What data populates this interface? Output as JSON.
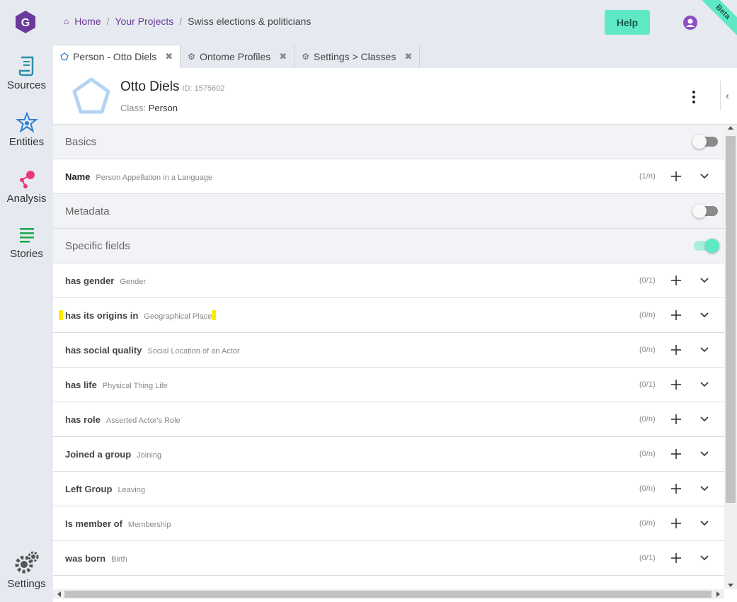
{
  "breadcrumb": {
    "home": "Home",
    "projects": "Your Projects",
    "current": "Swiss elections & politicians"
  },
  "header": {
    "help_label": "Help",
    "beta_label": "Beta"
  },
  "sidebar": {
    "sources": "Sources",
    "entities": "Entities",
    "analysis": "Analysis",
    "stories": "Stories",
    "settings": "Settings"
  },
  "tabs": [
    {
      "label": "Person - Otto Diels",
      "icon": "pentagon-icon",
      "active": true
    },
    {
      "label": "Ontome Profiles",
      "icon": "gears-icon",
      "active": false
    },
    {
      "label": "Settings > Classes",
      "icon": "gears-icon",
      "active": false
    }
  ],
  "entity": {
    "name": "Otto Diels",
    "id_label": "ID: 1575602",
    "class_prefix": "Class:",
    "class_name": "Person"
  },
  "sections": {
    "basics": {
      "label": "Basics",
      "toggle_on": false
    },
    "metadata": {
      "label": "Metadata",
      "toggle_on": false
    },
    "specific": {
      "label": "Specific fields",
      "toggle_on": true
    }
  },
  "fields": {
    "name": {
      "label": "Name",
      "type": "Person Appellation in a Language",
      "card": "(1/n)"
    },
    "gender": {
      "label": "has gender",
      "type": "Gender",
      "card": "(0/1)"
    },
    "origins": {
      "label": "has its origins in",
      "type": "Geographical Place",
      "card": "(0/n)"
    },
    "social": {
      "label": "has social quality",
      "type": "Social Location of an Actor",
      "card": "(0/n)"
    },
    "life": {
      "label": "has life",
      "type": "Physical Thing Life",
      "card": "(0/1)"
    },
    "role": {
      "label": "has role",
      "type": "Asserted Actor's Role",
      "card": "(0/n)"
    },
    "joined": {
      "label": "Joined a group",
      "type": "Joining",
      "card": "(0/n)"
    },
    "left": {
      "label": "Left Group",
      "type": "Leaving",
      "card": "(0/n)"
    },
    "member": {
      "label": "Is member of",
      "type": "Membership",
      "card": "(0/n)"
    },
    "born": {
      "label": "was born",
      "type": "Birth",
      "card": "(0/1)"
    }
  },
  "colors": {
    "accent": "#5ee8c5",
    "link": "#6a3a9a",
    "highlight": "#ffeb00"
  }
}
